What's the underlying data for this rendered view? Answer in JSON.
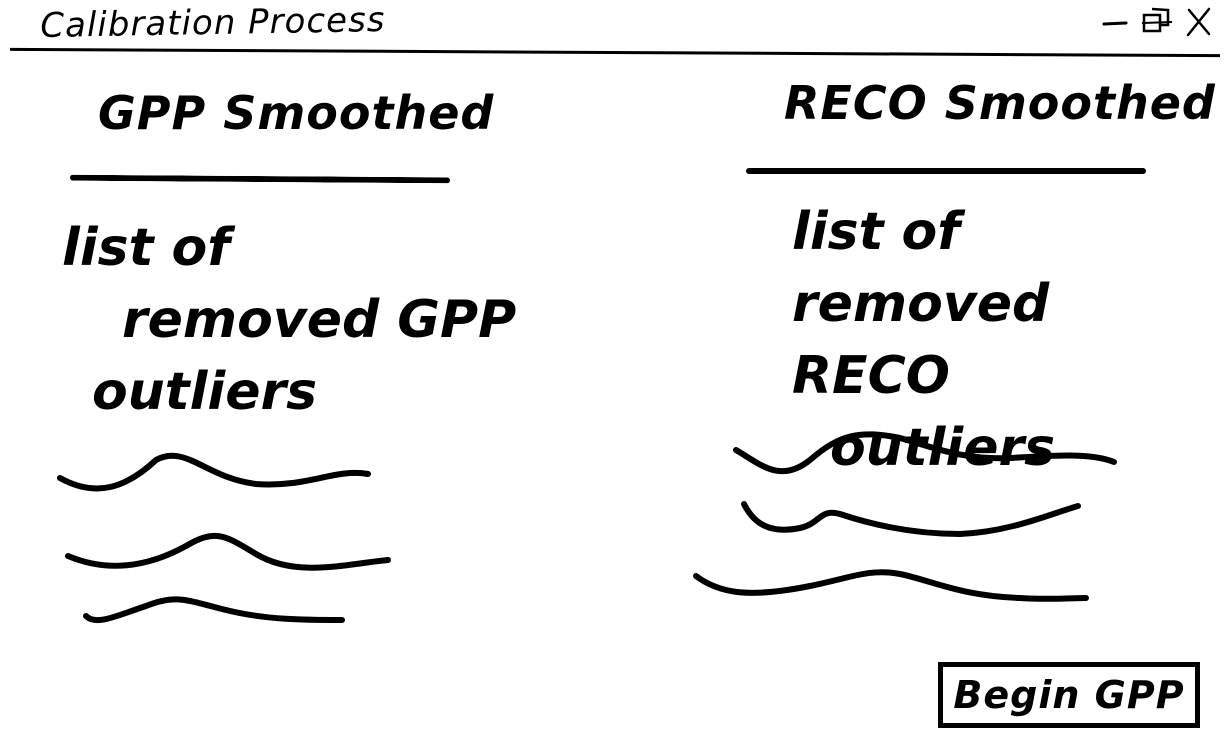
{
  "window": {
    "title": "Calibration Process",
    "controls": {
      "minimize_icon": "minimize-icon",
      "restore_icon": "restore-icon",
      "close_icon": "close-icon"
    }
  },
  "gpp_panel": {
    "title": "GPP Smoothed",
    "caption_lines": [
      "list of",
      "removed GPP",
      "outliers"
    ]
  },
  "reco_panel": {
    "title": "RECO Smoothed",
    "caption_lines": [
      "list of",
      "removed RECO",
      "outliers"
    ]
  },
  "actions": {
    "begin_label": "Begin GPP"
  },
  "colors": {
    "ink": "#000000",
    "background": "#ffffff"
  }
}
